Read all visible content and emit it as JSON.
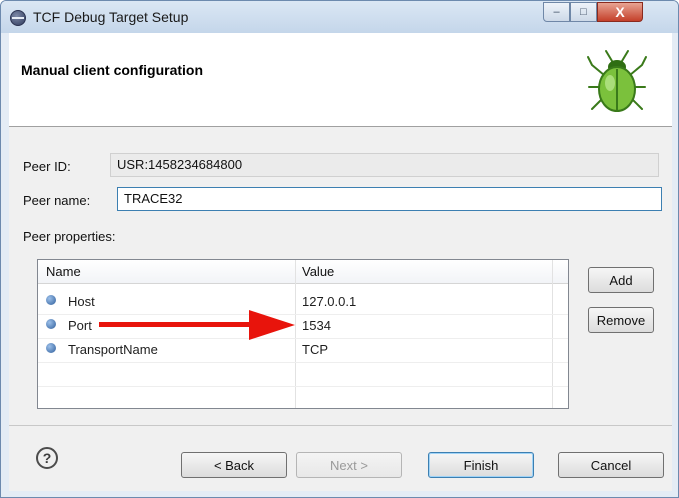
{
  "window": {
    "title": "TCF Debug Target Setup",
    "controls": {
      "minimize": "–",
      "maximize": "□",
      "close": "X"
    }
  },
  "banner": {
    "title": "Manual client configuration",
    "icon": "bug-icon"
  },
  "form": {
    "peer_id_label": "Peer ID:",
    "peer_id_value": "USR:1458234684800",
    "peer_name_label": "Peer name:",
    "peer_name_value": "TRACE32",
    "peer_properties_label": "Peer properties:"
  },
  "table": {
    "columns": [
      "Name",
      "Value"
    ],
    "rows": [
      {
        "name": "Host",
        "value": "127.0.0.1"
      },
      {
        "name": "Port",
        "value": "1534"
      },
      {
        "name": "TransportName",
        "value": "TCP"
      }
    ]
  },
  "side_buttons": {
    "add": "Add",
    "remove": "Remove"
  },
  "footer": {
    "help": "?",
    "back": "< Back",
    "next": "Next >",
    "finish": "Finish",
    "cancel": "Cancel"
  },
  "colors": {
    "annotation_arrow": "#e8140c",
    "dot": "#2e5d9a"
  }
}
